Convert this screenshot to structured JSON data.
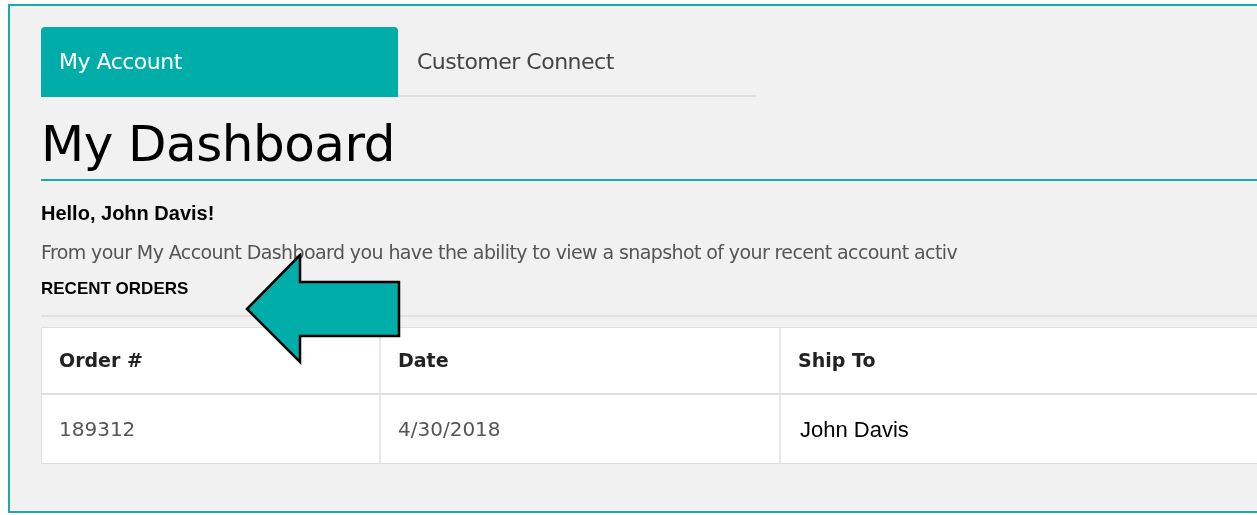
{
  "tabs": [
    {
      "label": "My Account",
      "selected": true
    },
    {
      "label": "Customer Connect",
      "selected": false
    }
  ],
  "title": "My Dashboard",
  "greeting": "Hello, John Davis!",
  "intro": "From your My Account Dashboard you have the ability to view a snapshot of your recent account activ",
  "section_heading": "RECENT ORDERS",
  "table": {
    "columns": [
      "Order #",
      "Date",
      "Ship To"
    ],
    "rows": [
      [
        "189312",
        "4/30/2018",
        "John Davis"
      ]
    ]
  }
}
